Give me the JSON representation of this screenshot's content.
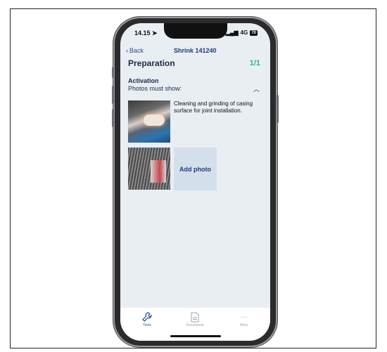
{
  "status_bar": {
    "time": "14.15",
    "network": "4G",
    "battery": "70"
  },
  "nav": {
    "back_label": "Back",
    "title": "Shrink 141240"
  },
  "section": {
    "title": "Preparation",
    "count": "1/1"
  },
  "activation": {
    "title": "Activation",
    "subtitle": "Photos must show:",
    "description": "Cleaning and grinding of casing surface for joint installation.",
    "add_photo_label": "Add photo"
  },
  "tabs": [
    {
      "label": "Tools",
      "icon": "wrench-icon",
      "active": true
    },
    {
      "label": "Documents",
      "icon": "document-icon",
      "active": false
    },
    {
      "label": "More",
      "icon": "more-icon",
      "active": false
    }
  ],
  "colors": {
    "accent": "#1f4fa0",
    "count": "#2bb48a",
    "background": "#e9eef3"
  }
}
